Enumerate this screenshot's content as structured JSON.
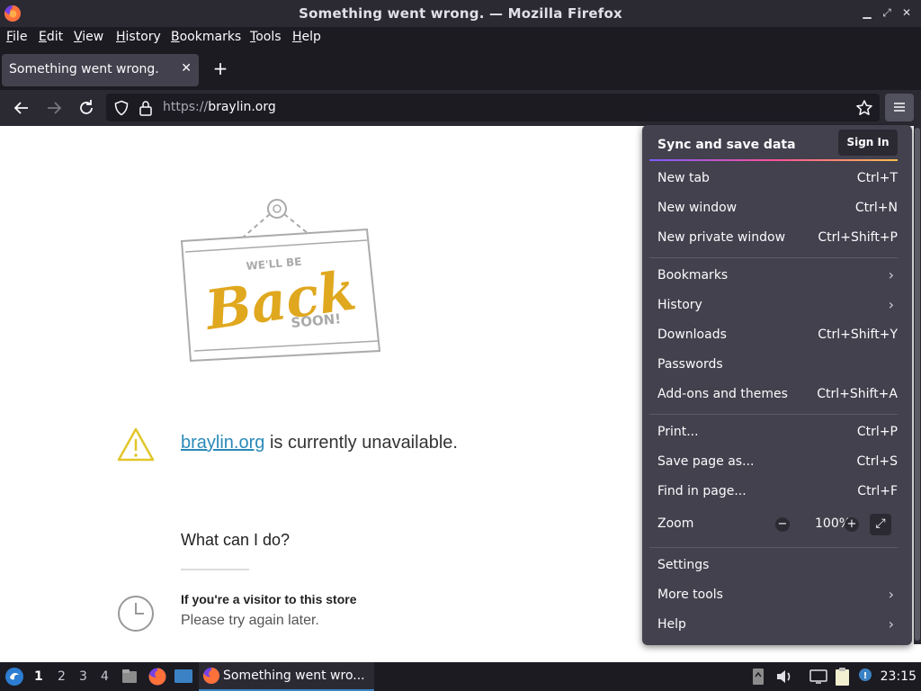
{
  "window": {
    "title": "Something went wrong. — Mozilla Firefox"
  },
  "menubar": {
    "items": [
      "File",
      "Edit",
      "View",
      "History",
      "Bookmarks",
      "Tools",
      "Help"
    ]
  },
  "tabs": [
    {
      "label": "Something went wrong."
    }
  ],
  "navbar": {
    "url_scheme": "https://",
    "url_host": "braylin.org"
  },
  "page": {
    "site_link": "braylin.org",
    "unavailable_text": " is currently unavailable.",
    "what_can_i_do": "What can I do?",
    "visitor_title": "If you're a visitor to this store",
    "visitor_text": "Please try again later.",
    "sign_lines": [
      "WE'LL BE",
      "Back",
      "SOON!"
    ]
  },
  "appmenu": {
    "sync_title": "Sync and save data",
    "sign_in": "Sign In",
    "new_tab": {
      "label": "New tab",
      "shortcut": "Ctrl+T"
    },
    "new_window": {
      "label": "New window",
      "shortcut": "Ctrl+N"
    },
    "new_private_window": {
      "label": "New private window",
      "shortcut": "Ctrl+Shift+P"
    },
    "bookmarks": {
      "label": "Bookmarks"
    },
    "history": {
      "label": "History"
    },
    "downloads": {
      "label": "Downloads",
      "shortcut": "Ctrl+Shift+Y"
    },
    "passwords": {
      "label": "Passwords"
    },
    "addons": {
      "label": "Add-ons and themes",
      "shortcut": "Ctrl+Shift+A"
    },
    "print": {
      "label": "Print...",
      "shortcut": "Ctrl+P"
    },
    "save_page": {
      "label": "Save page as...",
      "shortcut": "Ctrl+S"
    },
    "find": {
      "label": "Find in page...",
      "shortcut": "Ctrl+F"
    },
    "zoom": {
      "label": "Zoom",
      "value": "100%",
      "minus": "−",
      "plus": "+"
    },
    "settings": {
      "label": "Settings"
    },
    "more_tools": {
      "label": "More tools"
    },
    "help": {
      "label": "Help"
    }
  },
  "taskbar": {
    "workspaces": [
      "1",
      "2",
      "3",
      "4"
    ],
    "task_label": "Something went wro...",
    "clock": "23:15"
  },
  "colors": {
    "accent_link": "#2a8ab8",
    "warning": "#e2c62a",
    "sign_gold": "#e0a81e"
  }
}
